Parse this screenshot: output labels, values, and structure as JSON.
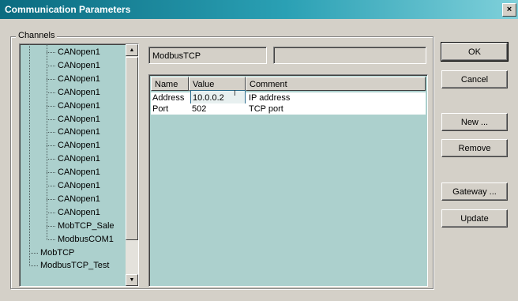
{
  "window": {
    "title": "Communication Parameters",
    "close_label": "×"
  },
  "channels": {
    "legend": "Channels",
    "items": [
      {
        "label": "CANopen1",
        "level": 2
      },
      {
        "label": "CANopen1",
        "level": 2
      },
      {
        "label": "CANopen1",
        "level": 2
      },
      {
        "label": "CANopen1",
        "level": 2
      },
      {
        "label": "CANopen1",
        "level": 2
      },
      {
        "label": "CANopen1",
        "level": 2
      },
      {
        "label": "CANopen1",
        "level": 2
      },
      {
        "label": "CANopen1",
        "level": 2
      },
      {
        "label": "CANopen1",
        "level": 2
      },
      {
        "label": "CANopen1",
        "level": 2
      },
      {
        "label": "CANopen1",
        "level": 2
      },
      {
        "label": "CANopen1",
        "level": 2
      },
      {
        "label": "CANopen1",
        "level": 2
      },
      {
        "label": "MobTCP_Sale",
        "level": 2
      },
      {
        "label": "ModbusCOM1",
        "level": 2
      },
      {
        "label": "MobTCP",
        "level": 1
      },
      {
        "label": "ModbusTCP_Test",
        "level": 1
      }
    ],
    "scroll_up_icon": "arrow-up-icon",
    "scroll_down_icon": "arrow-down-icon"
  },
  "selected_channel": {
    "name": "ModbusTCP",
    "info": ""
  },
  "params": {
    "columns": [
      "Name",
      "Value",
      "Comment"
    ],
    "rows": [
      {
        "name": "Address",
        "value": "10.0.0.2",
        "comment": "IP address"
      },
      {
        "name": "Port",
        "value": "502",
        "comment": "TCP port"
      }
    ]
  },
  "buttons": {
    "ok": "OK",
    "cancel": "Cancel",
    "new": "New ...",
    "remove": "Remove",
    "gateway": "Gateway ...",
    "update": "Update"
  }
}
